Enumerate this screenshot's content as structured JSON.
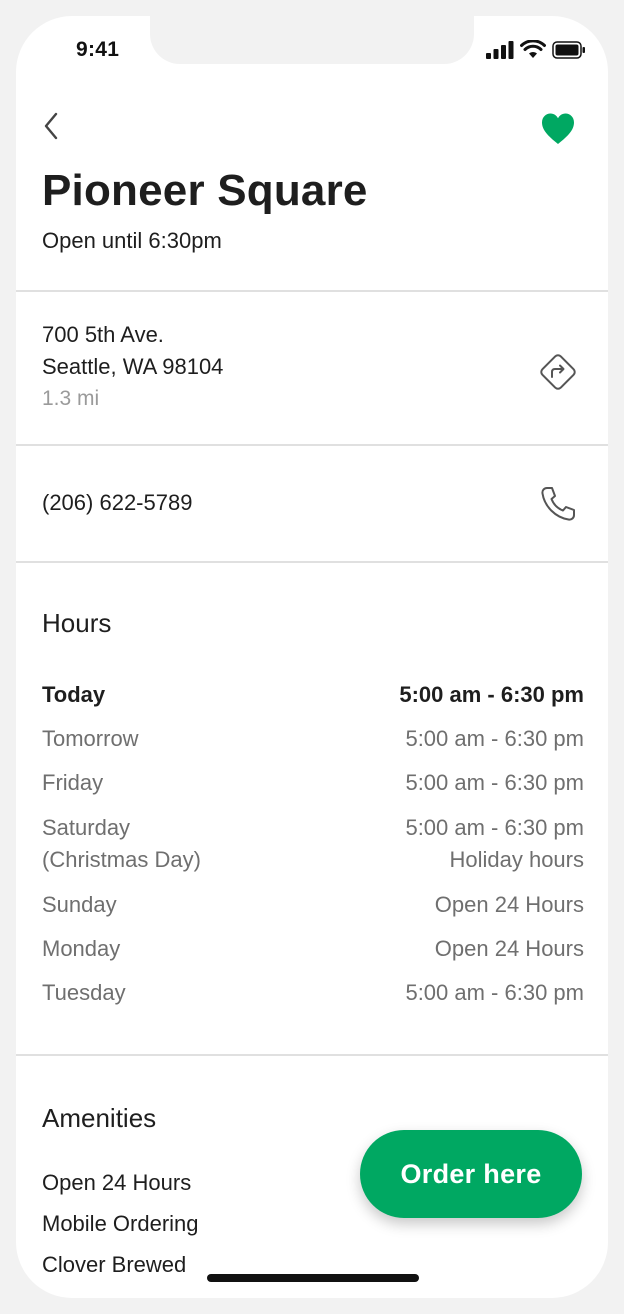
{
  "status_bar": {
    "time": "9:41"
  },
  "store": {
    "name": "Pioneer Square",
    "open_status": "Open until 6:30pm",
    "address_line1": "700 5th Ave.",
    "address_line2": "Seattle, WA 98104",
    "distance": "1.3 mi",
    "phone": "(206) 622-5789",
    "favorited": true
  },
  "hours": {
    "heading": "Hours",
    "rows": [
      {
        "day": "Today",
        "time": "5:00 am - 6:30 pm"
      },
      {
        "day": "Tomorrow",
        "time": "5:00 am - 6:30 pm"
      },
      {
        "day": "Friday",
        "time": "5:00 am - 6:30 pm"
      },
      {
        "day": "Saturday",
        "day_note": "(Christmas Day)",
        "time": "5:00 am - 6:30 pm",
        "time_note": "Holiday hours"
      },
      {
        "day": "Sunday",
        "time": "Open 24 Hours"
      },
      {
        "day": "Monday",
        "time": "Open 24 Hours"
      },
      {
        "day": "Tuesday",
        "time": "5:00 am - 6:30 pm"
      }
    ]
  },
  "amenities": {
    "heading": "Amenities",
    "items": [
      "Open 24 Hours",
      "Mobile Ordering",
      "Clover Brewed"
    ]
  },
  "order_button": {
    "label": "Order here"
  },
  "colors": {
    "brand_green": "#00a862",
    "text": "#1e1e1e",
    "muted": "#6f6f6f"
  },
  "icons": {
    "back": "chevron-left-icon",
    "favorite": "heart-icon",
    "directions": "directions-icon",
    "call": "phone-icon"
  }
}
